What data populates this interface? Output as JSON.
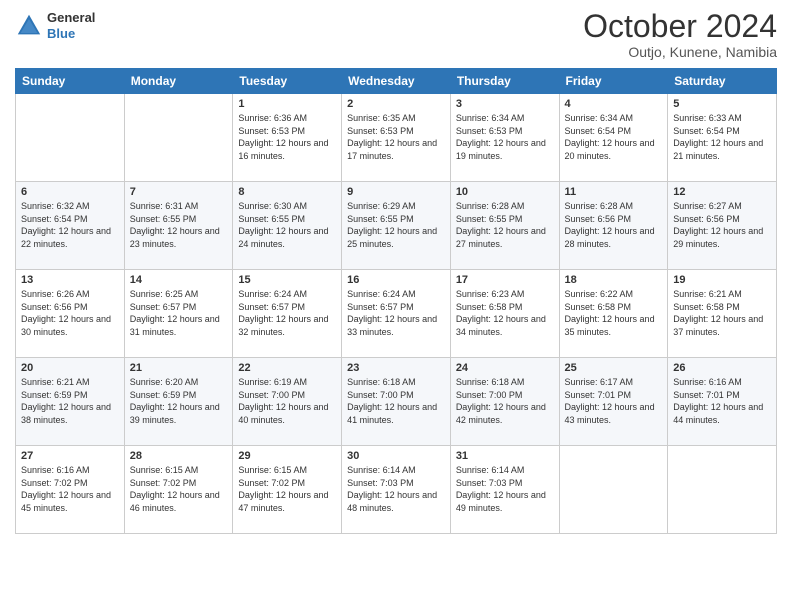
{
  "header": {
    "logo": {
      "line1": "General",
      "line2": "Blue"
    },
    "title": "October 2024",
    "subtitle": "Outjo, Kunene, Namibia"
  },
  "days_of_week": [
    "Sunday",
    "Monday",
    "Tuesday",
    "Wednesday",
    "Thursday",
    "Friday",
    "Saturday"
  ],
  "weeks": [
    [
      {
        "day": "",
        "detail": ""
      },
      {
        "day": "",
        "detail": ""
      },
      {
        "day": "1",
        "detail": "Sunrise: 6:36 AM\nSunset: 6:53 PM\nDaylight: 12 hours and 16 minutes."
      },
      {
        "day": "2",
        "detail": "Sunrise: 6:35 AM\nSunset: 6:53 PM\nDaylight: 12 hours and 17 minutes."
      },
      {
        "day": "3",
        "detail": "Sunrise: 6:34 AM\nSunset: 6:53 PM\nDaylight: 12 hours and 19 minutes."
      },
      {
        "day": "4",
        "detail": "Sunrise: 6:34 AM\nSunset: 6:54 PM\nDaylight: 12 hours and 20 minutes."
      },
      {
        "day": "5",
        "detail": "Sunrise: 6:33 AM\nSunset: 6:54 PM\nDaylight: 12 hours and 21 minutes."
      }
    ],
    [
      {
        "day": "6",
        "detail": "Sunrise: 6:32 AM\nSunset: 6:54 PM\nDaylight: 12 hours and 22 minutes."
      },
      {
        "day": "7",
        "detail": "Sunrise: 6:31 AM\nSunset: 6:55 PM\nDaylight: 12 hours and 23 minutes."
      },
      {
        "day": "8",
        "detail": "Sunrise: 6:30 AM\nSunset: 6:55 PM\nDaylight: 12 hours and 24 minutes."
      },
      {
        "day": "9",
        "detail": "Sunrise: 6:29 AM\nSunset: 6:55 PM\nDaylight: 12 hours and 25 minutes."
      },
      {
        "day": "10",
        "detail": "Sunrise: 6:28 AM\nSunset: 6:55 PM\nDaylight: 12 hours and 27 minutes."
      },
      {
        "day": "11",
        "detail": "Sunrise: 6:28 AM\nSunset: 6:56 PM\nDaylight: 12 hours and 28 minutes."
      },
      {
        "day": "12",
        "detail": "Sunrise: 6:27 AM\nSunset: 6:56 PM\nDaylight: 12 hours and 29 minutes."
      }
    ],
    [
      {
        "day": "13",
        "detail": "Sunrise: 6:26 AM\nSunset: 6:56 PM\nDaylight: 12 hours and 30 minutes."
      },
      {
        "day": "14",
        "detail": "Sunrise: 6:25 AM\nSunset: 6:57 PM\nDaylight: 12 hours and 31 minutes."
      },
      {
        "day": "15",
        "detail": "Sunrise: 6:24 AM\nSunset: 6:57 PM\nDaylight: 12 hours and 32 minutes."
      },
      {
        "day": "16",
        "detail": "Sunrise: 6:24 AM\nSunset: 6:57 PM\nDaylight: 12 hours and 33 minutes."
      },
      {
        "day": "17",
        "detail": "Sunrise: 6:23 AM\nSunset: 6:58 PM\nDaylight: 12 hours and 34 minutes."
      },
      {
        "day": "18",
        "detail": "Sunrise: 6:22 AM\nSunset: 6:58 PM\nDaylight: 12 hours and 35 minutes."
      },
      {
        "day": "19",
        "detail": "Sunrise: 6:21 AM\nSunset: 6:58 PM\nDaylight: 12 hours and 37 minutes."
      }
    ],
    [
      {
        "day": "20",
        "detail": "Sunrise: 6:21 AM\nSunset: 6:59 PM\nDaylight: 12 hours and 38 minutes."
      },
      {
        "day": "21",
        "detail": "Sunrise: 6:20 AM\nSunset: 6:59 PM\nDaylight: 12 hours and 39 minutes."
      },
      {
        "day": "22",
        "detail": "Sunrise: 6:19 AM\nSunset: 7:00 PM\nDaylight: 12 hours and 40 minutes."
      },
      {
        "day": "23",
        "detail": "Sunrise: 6:18 AM\nSunset: 7:00 PM\nDaylight: 12 hours and 41 minutes."
      },
      {
        "day": "24",
        "detail": "Sunrise: 6:18 AM\nSunset: 7:00 PM\nDaylight: 12 hours and 42 minutes."
      },
      {
        "day": "25",
        "detail": "Sunrise: 6:17 AM\nSunset: 7:01 PM\nDaylight: 12 hours and 43 minutes."
      },
      {
        "day": "26",
        "detail": "Sunrise: 6:16 AM\nSunset: 7:01 PM\nDaylight: 12 hours and 44 minutes."
      }
    ],
    [
      {
        "day": "27",
        "detail": "Sunrise: 6:16 AM\nSunset: 7:02 PM\nDaylight: 12 hours and 45 minutes."
      },
      {
        "day": "28",
        "detail": "Sunrise: 6:15 AM\nSunset: 7:02 PM\nDaylight: 12 hours and 46 minutes."
      },
      {
        "day": "29",
        "detail": "Sunrise: 6:15 AM\nSunset: 7:02 PM\nDaylight: 12 hours and 47 minutes."
      },
      {
        "day": "30",
        "detail": "Sunrise: 6:14 AM\nSunset: 7:03 PM\nDaylight: 12 hours and 48 minutes."
      },
      {
        "day": "31",
        "detail": "Sunrise: 6:14 AM\nSunset: 7:03 PM\nDaylight: 12 hours and 49 minutes."
      },
      {
        "day": "",
        "detail": ""
      },
      {
        "day": "",
        "detail": ""
      }
    ]
  ]
}
